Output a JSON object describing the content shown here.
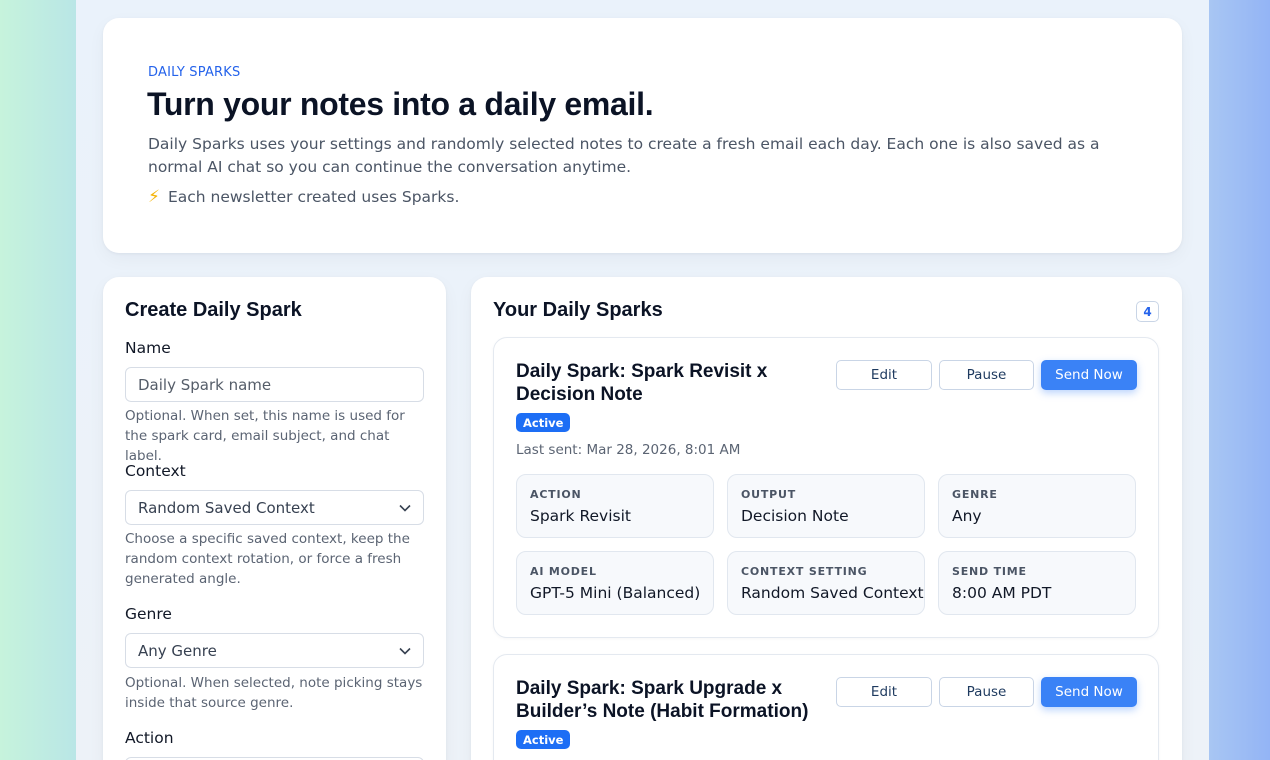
{
  "hero": {
    "eyebrow": "DAILY SPARKS",
    "title": "Turn your notes into a daily email.",
    "description": "Daily Sparks uses your settings and randomly selected notes to create a fresh email each day. Each one is also saved as a normal AI chat so you can continue the conversation anytime.",
    "note_icon": "lightning-bolt-icon",
    "note": "Each newsletter created uses Sparks."
  },
  "form": {
    "title": "Create Daily Spark",
    "name_label": "Name",
    "name_placeholder": "Daily Spark name",
    "name_help": "Optional. When set, this name is used for the spark card, email subject, and chat label.",
    "context_label": "Context",
    "context_value": "Random Saved Context",
    "context_help": "Choose a specific saved context, keep the random context rotation, or force a fresh generated angle.",
    "genre_label": "Genre",
    "genre_value": "Any Genre",
    "genre_help": "Optional. When selected, note picking stays inside that source genre.",
    "action_label": "Action"
  },
  "list": {
    "title": "Your Daily Sparks",
    "count": "4",
    "buttons": {
      "edit": "Edit",
      "pause": "Pause",
      "send": "Send Now"
    },
    "sparks": [
      {
        "title": "Daily Spark: Spark Revisit x Decision Note",
        "status": "Active",
        "last_sent": "Last sent: Mar 28, 2026, 8:01 AM",
        "fields": [
          {
            "key": "ACTION",
            "value": "Spark Revisit"
          },
          {
            "key": "OUTPUT",
            "value": "Decision Note"
          },
          {
            "key": "GENRE",
            "value": "Any"
          },
          {
            "key": "AI MODEL",
            "value": "GPT-5 Mini (Balanced)"
          },
          {
            "key": "CONTEXT SETTING",
            "value": "Random Saved Context"
          },
          {
            "key": "SEND TIME",
            "value": "8:00 AM PDT"
          }
        ]
      },
      {
        "title": "Daily Spark: Spark Upgrade x Builder’s Note (Habit Formation)",
        "status": "Active"
      }
    ]
  },
  "colors": {
    "accent": "#2563eb",
    "primary_button": "#3a82f6",
    "badge": "#1d6ef5",
    "bolt": "#f5b50b"
  }
}
